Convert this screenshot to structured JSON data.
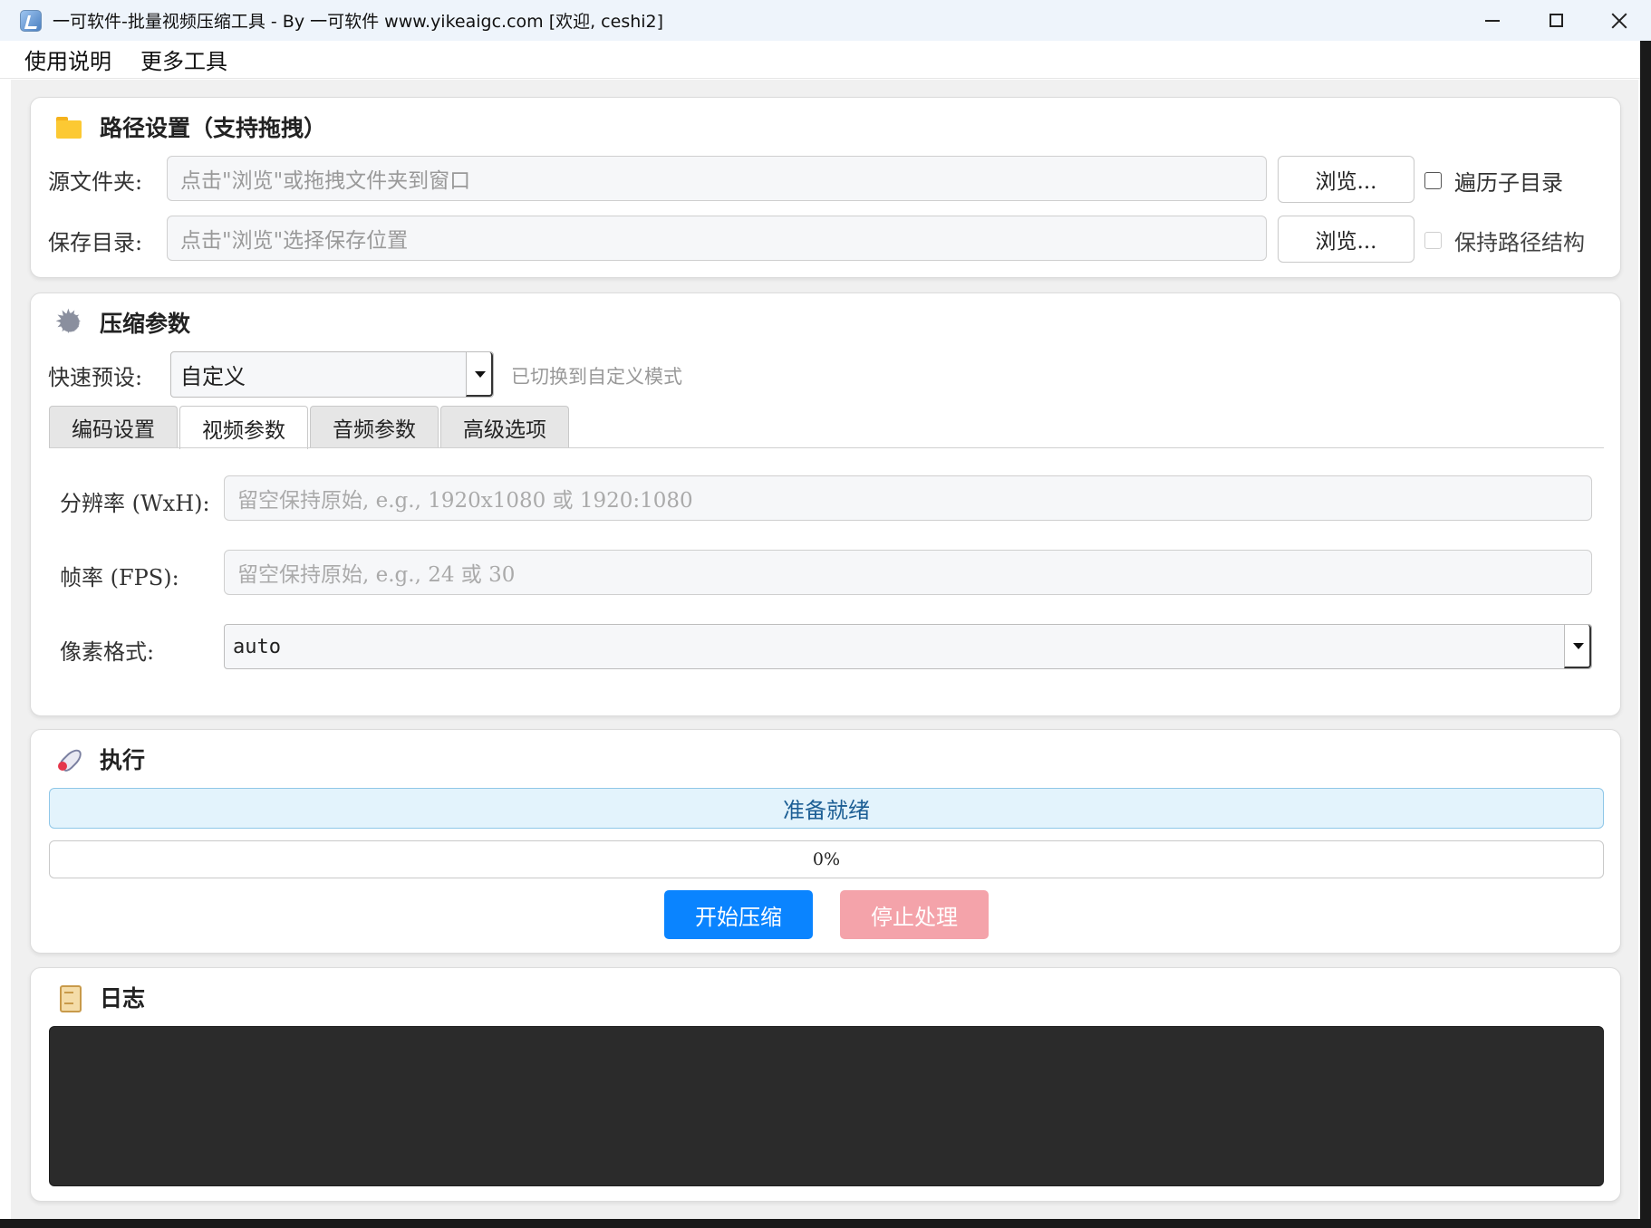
{
  "window": {
    "title": "一可软件-批量视频压缩工具 - By 一可软件 www.yikeaigc.com [欢迎, ceshi2]",
    "icon": "app-logo-icon",
    "controls": [
      "minimize-icon",
      "maximize-icon",
      "close-icon"
    ]
  },
  "menu": {
    "items": [
      {
        "label": "使用说明"
      },
      {
        "label": "更多工具"
      }
    ]
  },
  "path_section": {
    "title": "路径设置（支持拖拽）",
    "icon": "folder-icon",
    "source_label": "源文件夹:",
    "source_placeholder": "点击\"浏览\"或拖拽文件夹到窗口",
    "source_browse": "浏览...",
    "recurse_label": "遍历子目录",
    "recurse_checked": false,
    "save_label": "保存目录:",
    "save_placeholder": "点击\"浏览\"选择保存位置",
    "save_browse": "浏览...",
    "keep_structure_label": "保持路径结构",
    "keep_structure_checked": false,
    "keep_structure_disabled": true
  },
  "compress_section": {
    "title": "压缩参数",
    "icon": "gear-icon",
    "preset_label": "快速预设:",
    "preset_value": "自定义",
    "preset_hint": "已切换到自定义模式",
    "tabs": [
      {
        "label": "编码设置",
        "active": false
      },
      {
        "label": "视频参数",
        "active": true
      },
      {
        "label": "音频参数",
        "active": false
      },
      {
        "label": "高级选项",
        "active": false
      }
    ],
    "resolution_label": "分辨率 (WxH):",
    "resolution_placeholder": "留空保持原始, e.g., 1920x1080 或 1920:1080",
    "fps_label": "帧率 (FPS):",
    "fps_placeholder": "留空保持原始, e.g., 24 或 30",
    "pixfmt_label": "像素格式:",
    "pixfmt_value": "auto"
  },
  "run_section": {
    "title": "执行",
    "icon": "rocket-icon",
    "status": "准备就绪",
    "progress_text": "0%",
    "progress_fraction": 0,
    "start_label": "开始压缩",
    "stop_label": "停止处理",
    "colors": {
      "primary": "#0a84ff",
      "stop_disabled": "#f4a3aa",
      "status_bg": "#e3f3fc"
    }
  },
  "log_section": {
    "title": "日志",
    "icon": "scroll-icon",
    "log_background": "#2b2b2b"
  }
}
